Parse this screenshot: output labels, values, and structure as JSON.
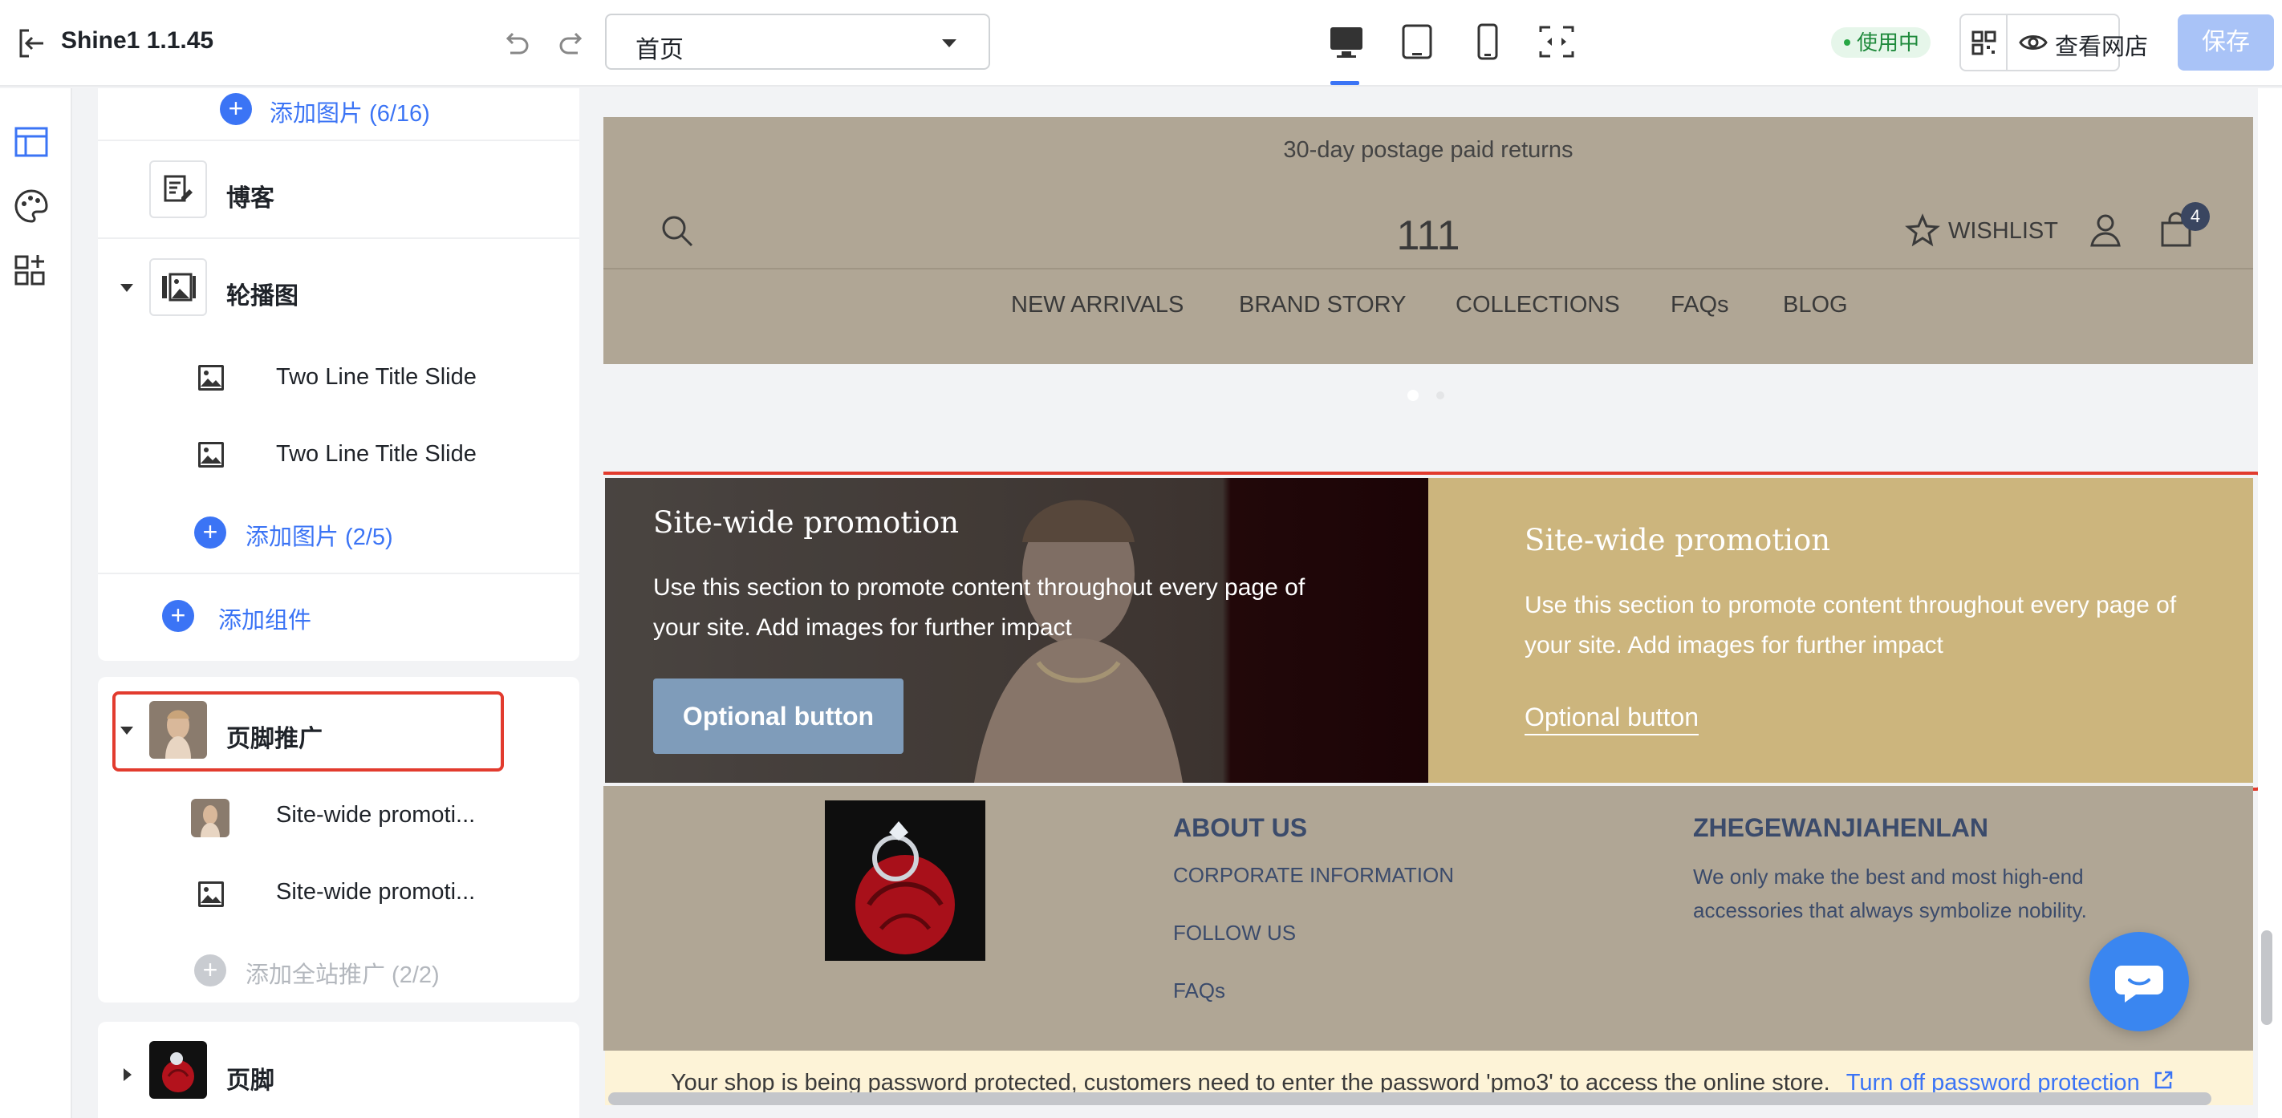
{
  "app": {
    "title": "Shine1 1.1.45",
    "page_select": "首页",
    "status": "使用中",
    "view_store": "查看网店",
    "save": "保存"
  },
  "sidebar": {
    "top_add_images": "添加图片 (6/16)",
    "blog": "博客",
    "slideshow": {
      "label": "轮播图",
      "slides": [
        "Two Line Title Slide",
        "Two Line Title Slide"
      ],
      "add_images": "添加图片 (2/5)"
    },
    "add_section": "添加组件",
    "footer_promo": {
      "label": "页脚推广",
      "items": [
        "Site-wide promoti...",
        "Site-wide promoti..."
      ],
      "add_promo": "添加全站推广 (2/2)"
    },
    "footer": "页脚"
  },
  "store": {
    "announcement": "30-day postage paid returns",
    "name": "111",
    "wishlist": "WISHLIST",
    "cart_count": "4",
    "nav": [
      "NEW ARRIVALS",
      "BRAND STORY",
      "COLLECTIONS",
      "FAQs",
      "BLOG"
    ],
    "promo_left": {
      "title": "Site-wide promotion",
      "text": "Use this section to promote content throughout every page of your site. Add images for further impact",
      "button": "Optional button"
    },
    "promo_right": {
      "title": "Site-wide promotion",
      "text": "Use this section to promote content throughout every page of your site. Add images for further impact",
      "button": "Optional button"
    },
    "footer": {
      "about_heading": "ABOUT US",
      "about_links": [
        "CORPORATE INFORMATION",
        "FOLLOW US",
        "FAQs"
      ],
      "brand_heading": "ZHEGEWANJIAHENLAN",
      "brand_text": "We only make the best and most high-end accessories that always symbolize nobility."
    },
    "password_notice": "Your shop is being password protected, customers need to enter the password 'pmo3' to access the online store.",
    "password_link": "Turn off password protection"
  },
  "colors": {
    "accent": "#3b74f5",
    "store_bg": "#b0a695",
    "promo_right_bg": "#ccb57d",
    "highlight": "#e23b2e"
  },
  "icons": [
    "exit-icon",
    "undo-icon",
    "redo-icon",
    "desktop-icon",
    "tablet-icon",
    "mobile-icon",
    "fullscreen-icon",
    "qr-code-icon",
    "eye-icon",
    "layout-icon",
    "palette-icon",
    "apps-icon",
    "search-icon",
    "star-icon",
    "user-icon",
    "bag-icon",
    "image-icon",
    "chat-icon",
    "external-link-icon"
  ]
}
